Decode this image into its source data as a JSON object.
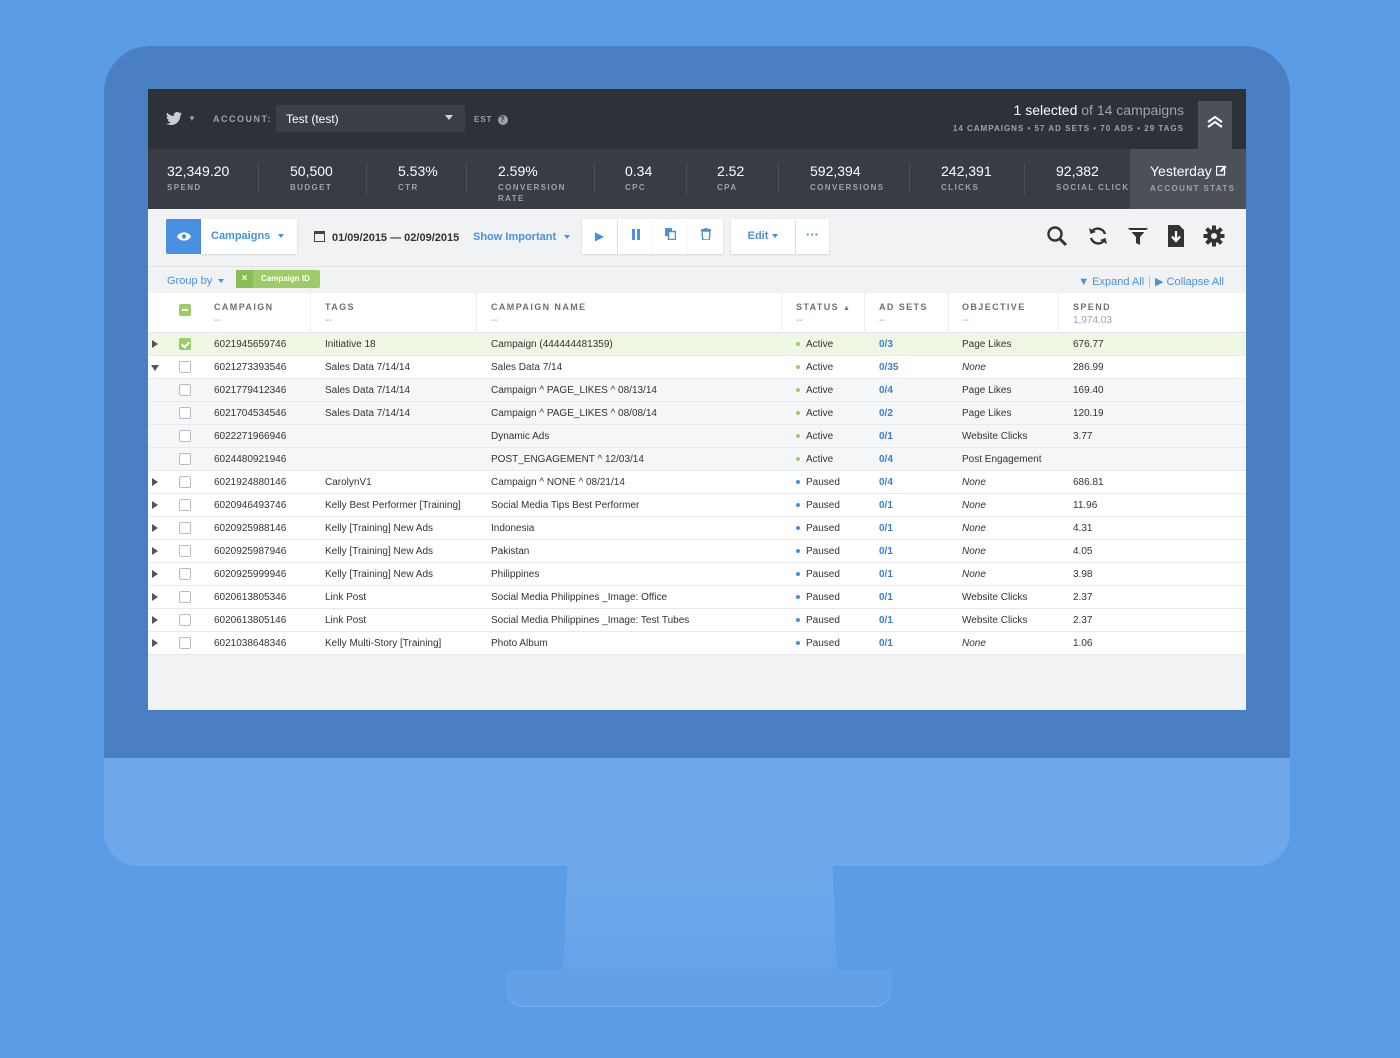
{
  "header": {
    "account_label": "ACCOUNT:",
    "account_value": "Test (test)",
    "timezone": "EST",
    "selected_count": "1 selected",
    "selected_of": "of 14 campaigns",
    "summary": "14 CAMPAIGNS • 57 AD SETS • 70 ADS • 29 TAGS"
  },
  "stats": [
    {
      "value": "32,349.20",
      "label": "SPEND"
    },
    {
      "value": "50,500",
      "label": "BUDGET"
    },
    {
      "value": "5.53%",
      "label": "CTR"
    },
    {
      "value": "2.59%",
      "label": "CONVERSION RATE"
    },
    {
      "value": "0.34",
      "label": "CPC"
    },
    {
      "value": "2.52",
      "label": "CPA"
    },
    {
      "value": "592,394",
      "label": "CONVERSIONS"
    },
    {
      "value": "242,391",
      "label": "CLICKS"
    },
    {
      "value": "92,382",
      "label": "SOCIAL CLICKS"
    }
  ],
  "account_stats": {
    "value": "Yesterday",
    "label": "ACCOUNT STATS"
  },
  "toolbar": {
    "level": "Campaigns",
    "date_range": "01/09/2015 — 02/09/2015",
    "show_important": "Show Important",
    "edit": "Edit",
    "more": "···"
  },
  "groupbar": {
    "group_by": "Group by",
    "chip": "Campaign ID",
    "expand_all": "Expand All",
    "collapse_all": "Collapse All"
  },
  "columns": {
    "campaign": "CAMPAIGN",
    "tags": "TAGS",
    "campaign_name": "CAMPAIGN NAME",
    "status": "STATUS",
    "ad_sets": "AD SETS",
    "objective": "OBJECTIVE",
    "spend": "SPEND",
    "placeholder": "--",
    "spend_total": "1,974.03"
  },
  "colors": {
    "active": "#9ccc65",
    "paused": "#4a90e2",
    "accent": "#4a90e2"
  },
  "rows": [
    {
      "id": "6021945659746",
      "tags": "Initiative 18",
      "name": "Campaign (444444481359)",
      "status": "Active",
      "adsets": "0/3",
      "objective": "Page Likes",
      "spend": "676.77"
    },
    {
      "id": "6021273393546",
      "tags": "Sales Data 7/14/14",
      "name": "Sales Data 7/14",
      "status": "Active",
      "adsets": "0/35",
      "objective": "None",
      "spend": "286.99"
    },
    {
      "id": "6021779412346",
      "tags": "Sales Data 7/14/14",
      "name": "Campaign ^ PAGE_LIKES ^ 08/13/14",
      "status": "Active",
      "adsets": "0/4",
      "objective": "Page Likes",
      "spend": "169.40"
    },
    {
      "id": "6021704534546",
      "tags": "Sales Data 7/14/14",
      "name": "Campaign ^ PAGE_LIKES ^ 08/08/14",
      "status": "Active",
      "adsets": "0/2",
      "objective": "Page Likes",
      "spend": "120.19"
    },
    {
      "id": "6022271966946",
      "tags": "",
      "name": "Dynamic Ads",
      "status": "Active",
      "adsets": "0/1",
      "objective": "Website Clicks",
      "spend": "3.77"
    },
    {
      "id": "6024480921946",
      "tags": "",
      "name": "POST_ENGAGEMENT ^ 12/03/14",
      "status": "Active",
      "adsets": "0/4",
      "objective": "Post Engagement",
      "spend": ""
    },
    {
      "id": "6021924880146",
      "tags": "CarolynV1",
      "name": "Campaign ^ NONE ^ 08/21/14",
      "status": "Paused",
      "adsets": "0/4",
      "objective": "None",
      "spend": "686.81"
    },
    {
      "id": "6020946493746",
      "tags": "Kelly Best Performer [Training]",
      "name": "Social Media Tips Best Performer",
      "status": "Paused",
      "adsets": "0/1",
      "objective": "None",
      "spend": "11.96"
    },
    {
      "id": "6020925988146",
      "tags": "Kelly [Training] New Ads",
      "name": "Indonesia",
      "status": "Paused",
      "adsets": "0/1",
      "objective": "None",
      "spend": "4.31"
    },
    {
      "id": "6020925987946",
      "tags": "Kelly [Training] New Ads",
      "name": "Pakistan",
      "status": "Paused",
      "adsets": "0/1",
      "objective": "None",
      "spend": "4.05"
    },
    {
      "id": "6020925999946",
      "tags": "Kelly [Training] New Ads",
      "name": "Philippines",
      "status": "Paused",
      "adsets": "0/1",
      "objective": "None",
      "spend": "3.98"
    },
    {
      "id": "6020613805346",
      "tags": "Link Post",
      "name": "Social Media Philippines _Image: Office",
      "status": "Paused",
      "adsets": "0/1",
      "objective": "Website Clicks",
      "spend": "2.37"
    },
    {
      "id": "6020613805146",
      "tags": "Link Post",
      "name": "Social Media Philippines _Image: Test Tubes",
      "status": "Paused",
      "adsets": "0/1",
      "objective": "Website Clicks",
      "spend": "2.37"
    },
    {
      "id": "6021038648346",
      "tags": "Kelly Multi-Story [Training]",
      "name": "Photo Album",
      "status": "Paused",
      "adsets": "0/1",
      "objective": "None",
      "spend": "1.06"
    }
  ]
}
